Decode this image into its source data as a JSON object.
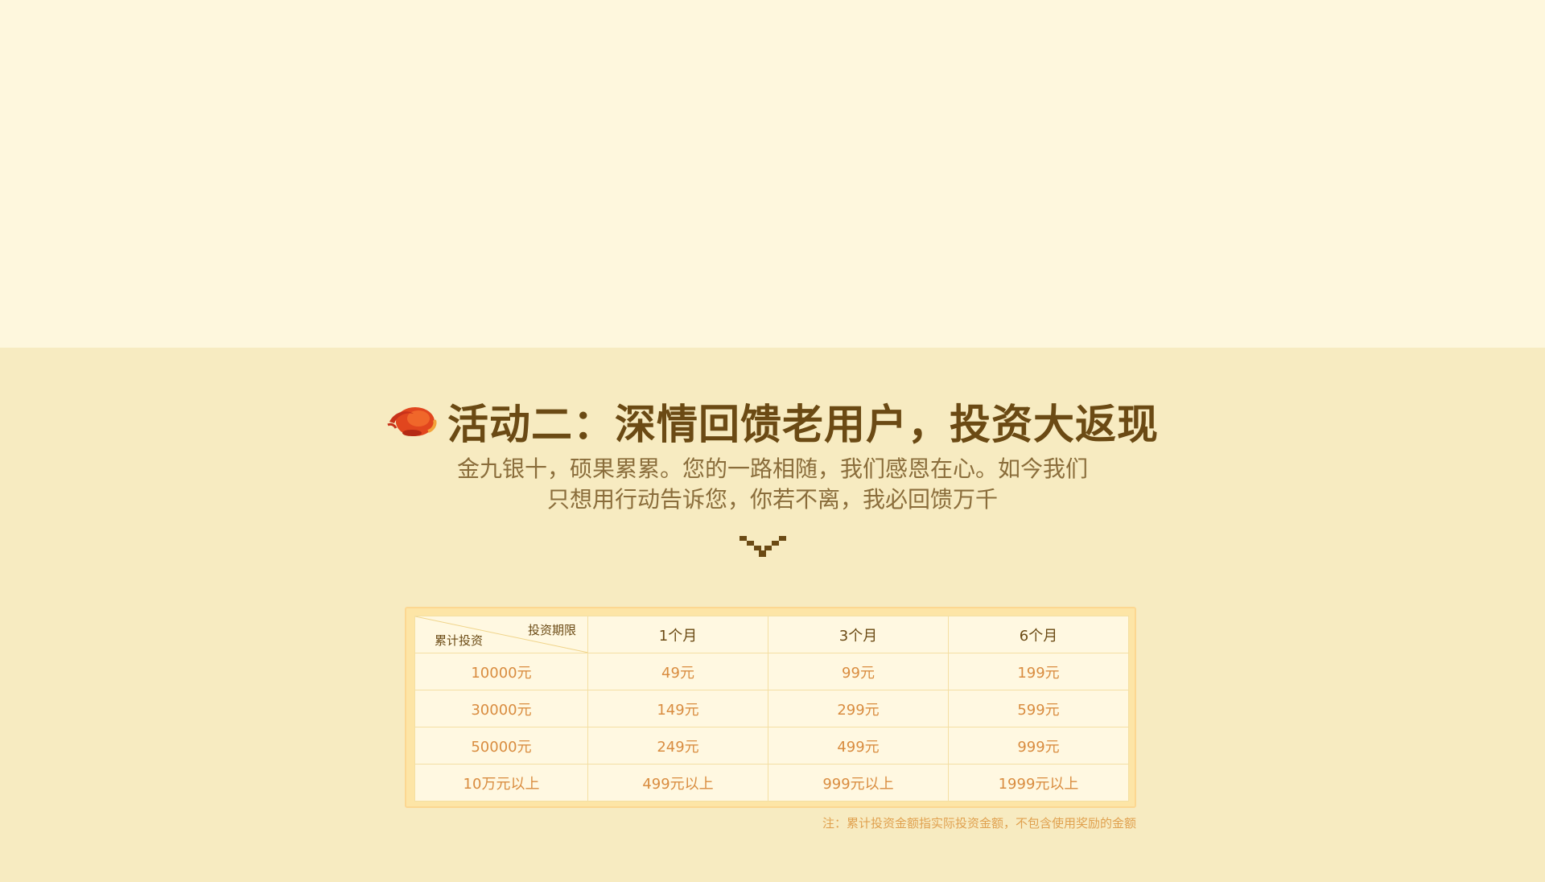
{
  "activity": {
    "title": "活动二：深情回馈老用户，投资大返现",
    "subtitle_line1": "金九银十，硕果累累。您的一路相随，我们感恩在心。如今我们",
    "subtitle_line2": "只想用行动告诉您，你若不离，我必回馈万千",
    "title_icon": "red-lucky-cloud-icon",
    "chevron_icon": "pixel-chevron-down-icon"
  },
  "table": {
    "corner_top": "投资期限",
    "corner_bottom": "累计投资",
    "columns": [
      "1个月",
      "3个月",
      "6个月"
    ],
    "rows": [
      {
        "amount": "10000元",
        "values": [
          "49元",
          "99元",
          "199元"
        ]
      },
      {
        "amount": "30000元",
        "values": [
          "149元",
          "299元",
          "599元"
        ]
      },
      {
        "amount": "50000元",
        "values": [
          "249元",
          "499元",
          "999元"
        ]
      },
      {
        "amount": "10万元以上",
        "values": [
          "499元以上",
          "999元以上",
          "1999元以上"
        ]
      }
    ]
  },
  "note": "注：累计投资金额指实际投资金额，不包含使用奖励的金额",
  "colors": {
    "top_background": "#fef7dd",
    "bottom_background": "#f7ebc1",
    "title": "#6b4a14",
    "value_text": "#d98c3f",
    "table_frame": "#fde5a6"
  }
}
